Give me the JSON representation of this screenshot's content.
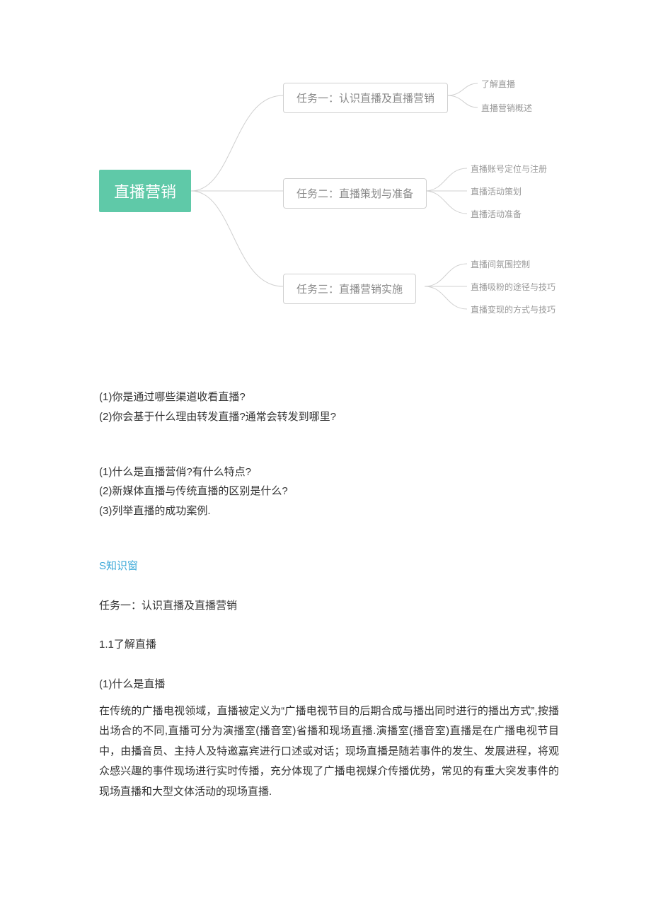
{
  "mindmap": {
    "root": "直播营销",
    "tasks": [
      {
        "label": "任务一：认识直播及直播营销",
        "leaves": [
          "了解直播",
          "直播营销概述"
        ]
      },
      {
        "label": "任务二：直播策划与准备",
        "leaves": [
          "直播账号定位与注册",
          "直播活动策划",
          "直播活动准备"
        ]
      },
      {
        "label": "任务三：直播营销实施",
        "leaves": [
          "直播间氛围控制",
          "直播吸粉的途径与技巧",
          "直播变现的方式与技巧"
        ]
      }
    ]
  },
  "questions_a": [
    "(1)你是通过哪些渠道收看直播?",
    "(2)你会基于什么理由转发直播?通常会转发到哪里?"
  ],
  "questions_b": [
    "(1)什么是直播营俏?有什么特点?",
    "(2)新媒体直播与传统直播的区别是什么?",
    "(3)列举直播的成功案例."
  ],
  "knowledge_label": "S知识窗",
  "task1_title": "任务一：认识直播及直播营销",
  "section_1_1": "1.1了解直播",
  "q_what": "(1)什么是直播",
  "body": "在传统的广播电视领域，直播被定义为“广播电视节目的后期合成与播出同时进行的播出方式”,按播出场合的不同,直播可分为演播室(播音室)省播和现场直播.演播室(播音室)直播是在广播电视节目中，由播音员、主持人及特邀嘉宾进行口述或对话；现场直播是随若事件的发生、发展进程，将观众感兴趣的事件现场进行实时传播，充分体现了广播电视媒介传播优势，常见的有重大突发事件的现场直播和大型文体活动的现场直播."
}
